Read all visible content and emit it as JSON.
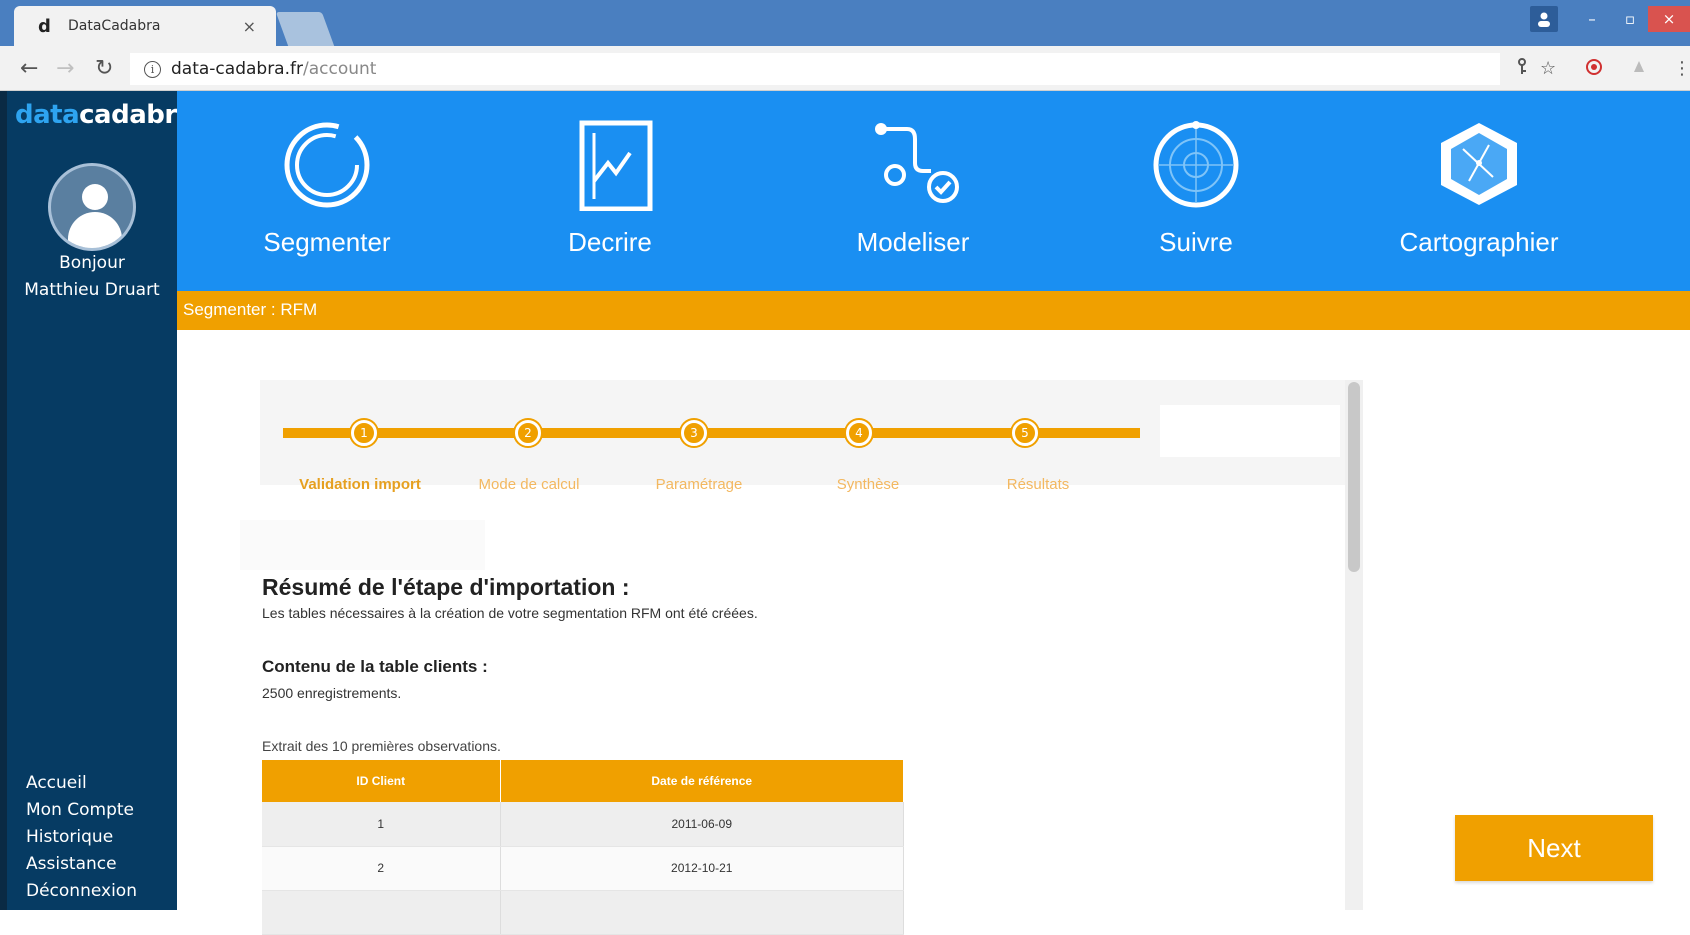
{
  "browser": {
    "tab_title": "DataCadabra",
    "tab_close": "×",
    "favicon": "d",
    "url_host": "data-cadabra.fr",
    "url_path": "/account",
    "window_controls": {
      "minimize": "–",
      "maximize": "▫",
      "close": "×"
    }
  },
  "sidebar": {
    "logo_part1": "data",
    "logo_part2": "cadabra",
    "greeting_line1": "Bonjour",
    "greeting_line2": "Matthieu Druart",
    "menu": [
      "Accueil",
      "Mon Compte",
      "Historique",
      "Assistance",
      "Déconnexion"
    ]
  },
  "topnav": {
    "items": [
      "Segmenter",
      "Decrire",
      "Modeliser",
      "Suivre",
      "Cartographier"
    ]
  },
  "breadcrumb": "Segmenter : RFM",
  "stepper": {
    "steps": [
      {
        "number": "1",
        "label": "Validation import"
      },
      {
        "number": "2",
        "label": "Mode de calcul"
      },
      {
        "number": "3",
        "label": "Paramétrage"
      },
      {
        "number": "4",
        "label": "Synthèse"
      },
      {
        "number": "5",
        "label": "Résultats"
      }
    ]
  },
  "content": {
    "title": "Résumé de l'étape d'importation :",
    "subtitle": "Les tables nécessaires à la création de votre segmentation RFM ont été créées.",
    "table_heading": "Contenu de la table clients :",
    "record_count": "2500 enregistrements.",
    "extract_note": "Extrait des 10 premières observations.",
    "table": {
      "headers": [
        "ID Client",
        "Date de référence"
      ],
      "rows": [
        [
          "1",
          "2011-06-09"
        ],
        [
          "2",
          "2012-10-21"
        ]
      ]
    }
  },
  "next_button": "Next",
  "colors": {
    "topnav": "#1a8ff2",
    "sidebar": "#063b63",
    "accent": "#f0a000"
  }
}
